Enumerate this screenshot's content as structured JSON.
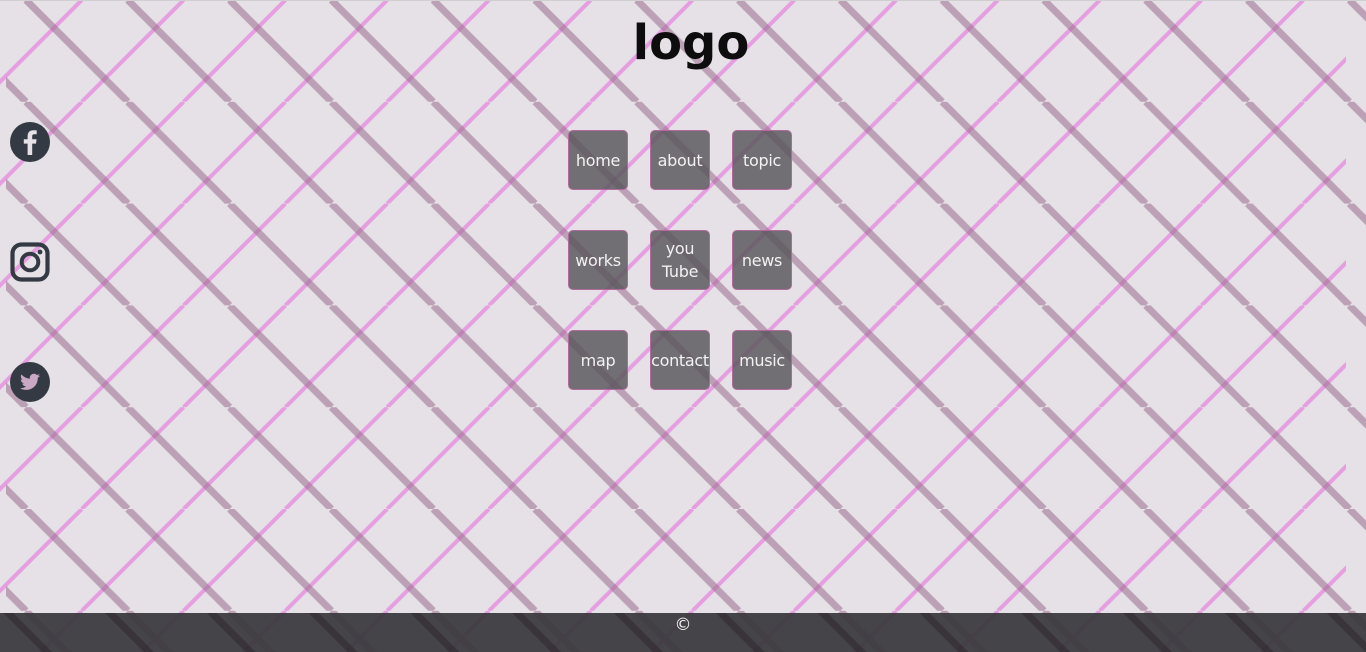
{
  "header": {
    "logo_text": "logo"
  },
  "social": [
    {
      "name": "facebook",
      "icon": "facebook-icon"
    },
    {
      "name": "instagram",
      "icon": "instagram-icon"
    },
    {
      "name": "twitter",
      "icon": "twitter-icon"
    }
  ],
  "nav": {
    "items": [
      {
        "label": "home"
      },
      {
        "label": "about"
      },
      {
        "label": "topic"
      },
      {
        "label": "works"
      },
      {
        "label": "you Tube"
      },
      {
        "label": "news"
      },
      {
        "label": "map"
      },
      {
        "label": "contact"
      },
      {
        "label": "music"
      }
    ]
  },
  "footer": {
    "copyright": "©"
  },
  "colors": {
    "background": "#e5e1e6",
    "pink_stripe": "#e59ee0",
    "dark_stripe": "#b898ae",
    "button_bg": "#58565a",
    "button_border": "#b06a9e",
    "icon_color": "#343a43",
    "footer_bg": "#3c3b3f"
  }
}
